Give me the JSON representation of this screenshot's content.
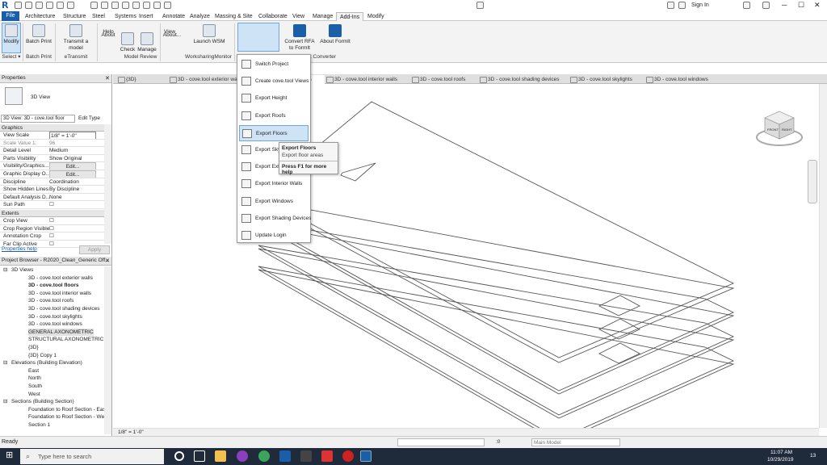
{
  "menu": [
    "Architecture",
    "Structure",
    "Steel",
    "Systems",
    "Insert",
    "Annotate",
    "Analyze",
    "Massing & Site",
    "Collaborate",
    "View",
    "Manage",
    "Add-Ins",
    "Modify"
  ],
  "file_tab": "File",
  "title_right": {
    "sign_in": "Sign In"
  },
  "ribbon": {
    "buttons": [
      {
        "label": "Modify",
        "name": "modify-button"
      },
      {
        "label": "Batch Print",
        "name": "batch-print-button"
      },
      {
        "label": "Transmit a model",
        "name": "transmit-model-button"
      },
      {
        "label": "Help",
        "name": "help-button"
      },
      {
        "label": "About",
        "name": "about-button"
      },
      {
        "label": "Check",
        "name": "check-button"
      },
      {
        "label": "Manage",
        "name": "manage-button"
      },
      {
        "label": "View",
        "name": "view-button"
      },
      {
        "label": "About...",
        "name": "about2-button"
      },
      {
        "label": "Launch WSM",
        "name": "launch-wsm-button"
      },
      {
        "label": "Switch Project",
        "name": "switch-project-button"
      },
      {
        "label": "Convert RFA to FormIt",
        "name": "convert-rfa-button"
      },
      {
        "label": "About FormIt",
        "name": "about-formit-button"
      }
    ],
    "panels": [
      "Select ▾",
      "Batch Print",
      "eTransmit",
      "Model Review",
      "WorksharingMonitor",
      "t Converter"
    ]
  },
  "tabs": [
    "{3D}",
    "3D - cove.tool exterior wal",
    "3D - cove.tool floors",
    "3D - cove.tool interior walls",
    "3D - cove.tool roofs",
    "3D - cove.tool shading devices",
    "3D - cove.tool skylights",
    "3D - cove.tool windows"
  ],
  "properties": {
    "title": "Properties",
    "type_name": "3D View",
    "view_selector": "3D View: 3D - cove.tool floor",
    "edit_type": "Edit Type",
    "section_graphics": "Graphics",
    "rows": [
      {
        "name": "View Scale",
        "value": "1/8\" = 1'-0\""
      },
      {
        "name": "Scale Value    1:",
        "value": "96"
      },
      {
        "name": "Detail Level",
        "value": "Medium"
      },
      {
        "name": "Parts Visibility",
        "value": "Show Original"
      },
      {
        "name": "Visibility/Graphics...",
        "value": "Edit..."
      },
      {
        "name": "Graphic Display O...",
        "value": "Edit..."
      },
      {
        "name": "Discipline",
        "value": "Coordination"
      },
      {
        "name": "Show Hidden Lines",
        "value": "By Discipline"
      },
      {
        "name": "Default Analysis D...",
        "value": "None"
      },
      {
        "name": "Sun Path",
        "value": ""
      }
    ],
    "section_extents": "Extents",
    "extent_rows": [
      "Crop View",
      "Crop Region Visible",
      "Annotation Crop",
      "Far Clip Active"
    ],
    "help_link": "Properties help",
    "apply": "Apply"
  },
  "browser": {
    "title": "Project Browser - R2020_Clean_Generic Off...",
    "items": [
      {
        "text": "3D Views",
        "level": 1,
        "bold": false
      },
      {
        "text": "3D - cove.tool exterior walls",
        "level": 2,
        "bold": false
      },
      {
        "text": "3D - cove.tool floors",
        "level": 2,
        "bold": true
      },
      {
        "text": "3D - cove.tool interior walls",
        "level": 2,
        "bold": false
      },
      {
        "text": "3D - cove.tool roofs",
        "level": 2,
        "bold": false
      },
      {
        "text": "3D - cove.tool shading devices",
        "level": 2,
        "bold": false
      },
      {
        "text": "3D - cove.tool skylights",
        "level": 2,
        "bold": false
      },
      {
        "text": "3D - cove.tool windows",
        "level": 2,
        "bold": false
      },
      {
        "text": "GENERAL AXONOMETRIC",
        "level": 2,
        "bold": false
      },
      {
        "text": "STRUCTURAL AXONOMETRIC",
        "level": 2,
        "bold": false
      },
      {
        "text": "{3D}",
        "level": 2,
        "bold": false
      },
      {
        "text": "{3D} Copy 1",
        "level": 2,
        "bold": false
      },
      {
        "text": "Elevations (Building Elevation)",
        "level": 1,
        "bold": false
      },
      {
        "text": "East",
        "level": 2,
        "bold": false
      },
      {
        "text": "North",
        "level": 2,
        "bold": false
      },
      {
        "text": "South",
        "level": 2,
        "bold": false
      },
      {
        "text": "West",
        "level": 2,
        "bold": false
      },
      {
        "text": "Sections (Building Section)",
        "level": 1,
        "bold": false
      },
      {
        "text": "Foundation to Roof Section - Eas",
        "level": 2,
        "bold": false
      },
      {
        "text": "Foundation to Roof Section - We",
        "level": 2,
        "bold": false
      },
      {
        "text": "Section 1",
        "level": 2,
        "bold": false
      }
    ]
  },
  "dropdown": [
    "Switch Project",
    "Create cove.tool Views",
    "Export Height",
    "Export Roofs",
    "Export Floors",
    "Export Skyl",
    "Export Exte",
    "Export Interior Walls",
    "Export Windows",
    "Export Shading Devices",
    "Update Login"
  ],
  "tooltip": {
    "title": "Export Floors",
    "desc": "Export floor areas",
    "help": "Press F1 for more help"
  },
  "viewcube": {
    "front": "FRONT",
    "right": "RIGHT"
  },
  "view_scale": "1/8\" = 1'-0\"",
  "status": {
    "ready": "Ready",
    "zero": ":0",
    "model": "Main Model"
  },
  "taskbar": {
    "search_placeholder": "Type here to search",
    "time": "11:07 AM",
    "date": "10/29/2019",
    "notif": "13"
  }
}
